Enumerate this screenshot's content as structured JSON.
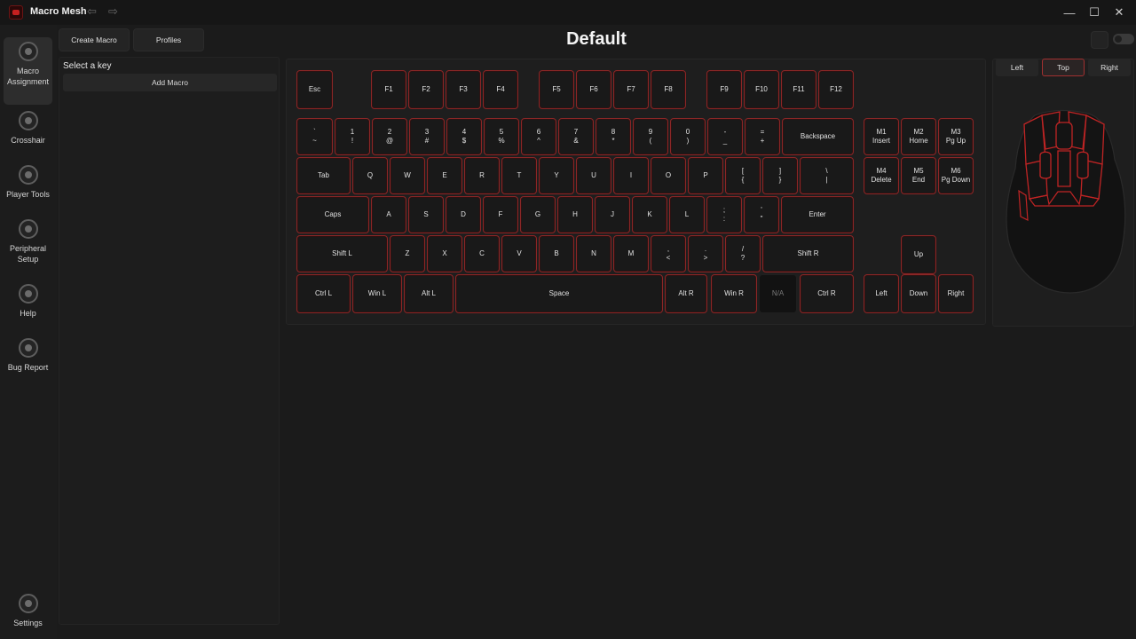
{
  "app": {
    "title": "Macro Mesh",
    "window_controls": [
      "—",
      "☐",
      "✕"
    ]
  },
  "sidebar": {
    "items": [
      {
        "label": "Macro Assignment",
        "lines": [
          "Macro",
          "Assignment"
        ],
        "icon": "keyboard-icon",
        "active": true
      },
      {
        "label": "Crosshair",
        "lines": [
          "Crosshair"
        ],
        "icon": "crosshair-icon",
        "active": false
      },
      {
        "label": "Player Tools",
        "lines": [
          "Player Tools"
        ],
        "icon": "player-tools-icon",
        "active": false
      },
      {
        "label": "Peripheral Setup",
        "lines": [
          "Peripheral",
          "Setup"
        ],
        "icon": "peripheral-icon",
        "active": false
      },
      {
        "label": "Help",
        "lines": [
          "Help"
        ],
        "icon": "help-icon",
        "active": false
      },
      {
        "label": "Bug Report",
        "lines": [
          "Bug Report"
        ],
        "icon": "bug-icon",
        "active": false
      }
    ],
    "settings": {
      "label": "Settings",
      "icon": "gear-icon"
    }
  },
  "toolbar": {
    "create_macro": "Create Macro",
    "profiles": "Profiles"
  },
  "page": {
    "title": "Default"
  },
  "left_panel": {
    "heading": "Select a key",
    "add_macro": "Add Macro"
  },
  "keyboard": {
    "rows": [
      [
        [
          "Esc"
        ]
      ],
      [
        [
          "F1"
        ],
        [
          "F2"
        ],
        [
          "F3"
        ],
        [
          "F4"
        ]
      ],
      [
        [
          "F5"
        ],
        [
          "F6"
        ],
        [
          "F7"
        ],
        [
          "F8"
        ]
      ],
      [
        [
          "F9"
        ],
        [
          "F10"
        ],
        [
          "F11"
        ],
        [
          "F12"
        ]
      ],
      [
        [
          "`",
          "~"
        ],
        [
          "1",
          "!"
        ],
        [
          "2",
          "@"
        ],
        [
          "3",
          "#"
        ],
        [
          "4",
          "$"
        ],
        [
          "5",
          "%"
        ],
        [
          "6",
          "^"
        ],
        [
          "7",
          "&"
        ],
        [
          "8",
          "*"
        ],
        [
          "9",
          "("
        ],
        [
          "0",
          ")"
        ],
        [
          "-",
          "_"
        ],
        [
          "=",
          "+"
        ],
        [
          "Backspace"
        ]
      ],
      [
        [
          "Tab"
        ],
        [
          "Q"
        ],
        [
          "W"
        ],
        [
          "E"
        ],
        [
          "R"
        ],
        [
          "T"
        ],
        [
          "Y"
        ],
        [
          "U"
        ],
        [
          "I"
        ],
        [
          "O"
        ],
        [
          "P"
        ],
        [
          "[",
          "{"
        ],
        [
          "]",
          "}"
        ],
        [
          "\\",
          "|"
        ]
      ],
      [
        [
          "Caps"
        ],
        [
          "A"
        ],
        [
          "S"
        ],
        [
          "D"
        ],
        [
          "F"
        ],
        [
          "G"
        ],
        [
          "H"
        ],
        [
          "J"
        ],
        [
          "K"
        ],
        [
          "L"
        ],
        [
          ";",
          ":"
        ],
        [
          "'",
          "\""
        ],
        [
          "Enter"
        ]
      ],
      [
        [
          "Shift L"
        ],
        [
          "Z"
        ],
        [
          "X"
        ],
        [
          "C"
        ],
        [
          "V"
        ],
        [
          "B"
        ],
        [
          "N"
        ],
        [
          "M"
        ],
        [
          ",",
          "<"
        ],
        [
          ".",
          ">"
        ],
        [
          "/",
          "?"
        ],
        [
          "Shift R"
        ]
      ],
      [
        [
          "Ctrl L"
        ],
        [
          "Win L"
        ],
        [
          "Alt L"
        ],
        [
          "Space"
        ],
        [
          "Alt R"
        ],
        [
          "Win R"
        ],
        [
          "N/A"
        ],
        [
          "Ctrl R"
        ]
      ]
    ],
    "macro_keys": [
      [
        "M1",
        "Insert"
      ],
      [
        "M2",
        "Home"
      ],
      [
        "M3",
        "Pg Up"
      ],
      [
        "M4",
        "Delete"
      ],
      [
        "M5",
        "End"
      ],
      [
        "M6",
        "Pg Down"
      ]
    ],
    "arrows": [
      [
        "Up"
      ],
      [
        "Left"
      ],
      [
        "Down"
      ],
      [
        "Right"
      ]
    ],
    "accent_color": "#8a2626",
    "disabled_key": "N/A"
  },
  "mouse": {
    "views": [
      "Left",
      "Top",
      "Right"
    ],
    "selected_view": "Top",
    "accent_color": "#c02424"
  }
}
